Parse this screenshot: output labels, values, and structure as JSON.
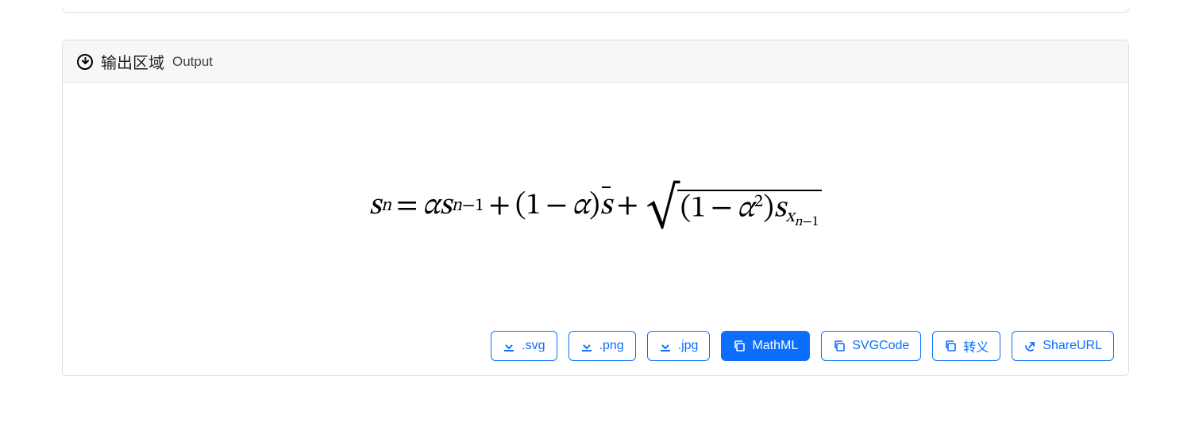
{
  "panel": {
    "title_main": "输出区域",
    "title_sub": "Output"
  },
  "formula": {
    "latex": "s_n = \\alpha s_{n-1} + (1 - \\alpha)\\bar{s} + \\sqrt{(1 - \\alpha^2)s_{x_{n-1}}}",
    "display": "sₙ = α sₙ₋₁ + (1 − α) s̄ + √((1 − α²) s_{xₙ₋₁})"
  },
  "buttons": {
    "svg": ".svg",
    "png": ".png",
    "jpg": ".jpg",
    "mathml": "MathML",
    "svgcode": "SVGCode",
    "escape": "转义",
    "shareurl": "ShareURL"
  }
}
